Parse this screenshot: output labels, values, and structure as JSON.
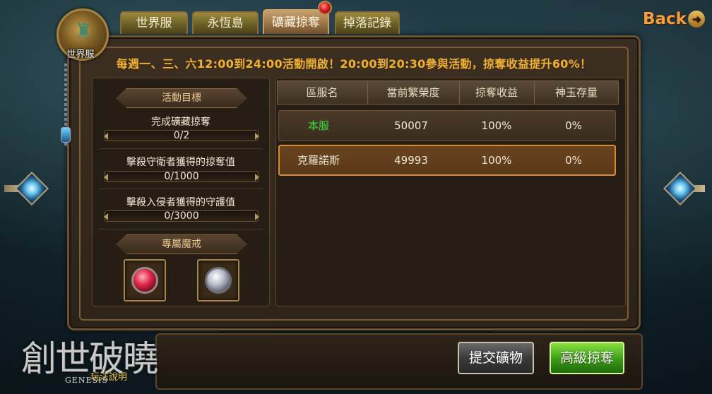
{
  "tabs": [
    {
      "label": "世界服",
      "active": false
    },
    {
      "label": "永恆島",
      "active": false
    },
    {
      "label": "礦藏掠奪",
      "active": true
    },
    {
      "label": "掉落記錄",
      "active": false
    }
  ],
  "emblem": {
    "label": "世界服"
  },
  "back": {
    "label": "Back"
  },
  "announcement": "每週一、三、六12:00到24:00活動開啟！20:00到20:30參與活動，掠奪收益提升60%！",
  "goals": {
    "header": "活動目標",
    "items": [
      {
        "label": "完成礦藏掠奪",
        "progress": "0/2"
      },
      {
        "label": "擊殺守衛者獲得的掠奪值",
        "progress": "0/1000"
      },
      {
        "label": "擊殺入侵者獲得的守護值",
        "progress": "0/3000"
      }
    ]
  },
  "rings": {
    "header": "專屬魔戒",
    "items": [
      {
        "icon": "red-gem-ring-icon"
      },
      {
        "icon": "silver-ring-icon"
      }
    ]
  },
  "table": {
    "headers": [
      "區服名",
      "當前繁榮度",
      "掠奪收益",
      "神玉存量"
    ],
    "rows": [
      {
        "server": "本服",
        "prosperity": "50007",
        "plunder": "100%",
        "jade": "0%",
        "highlight": false
      },
      {
        "server": "克羅諾斯",
        "prosperity": "49993",
        "plunder": "100%",
        "jade": "0%",
        "highlight": true
      }
    ]
  },
  "buttons": {
    "submit": "提交礦物",
    "advanced": "高級掠奪"
  },
  "logo": {
    "title": "創世破曉",
    "subtitle": "玩法說明",
    "english": "GENESIS"
  },
  "colors": {
    "announce": "#f0b030",
    "green_server": "#38e038",
    "highlight_border": "#d88a30"
  }
}
